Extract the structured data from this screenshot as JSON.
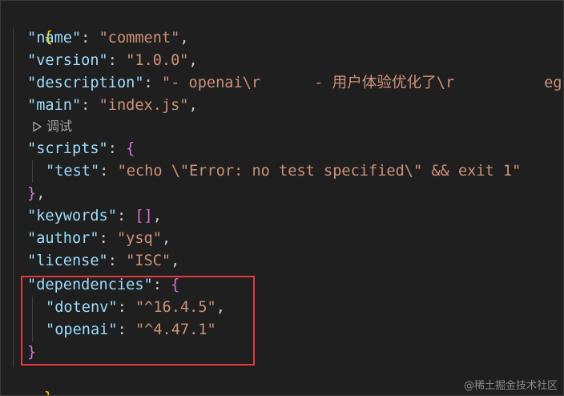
{
  "editor": {
    "open_brace": "{",
    "close_brace": "}",
    "codelens_label": "调试",
    "codelens_icon": "play-icon",
    "lines": {
      "name": {
        "key": "\"name\"",
        "sep": ": ",
        "value": "\"comment\"",
        "end": ","
      },
      "version": {
        "key": "\"version\"",
        "sep": ": ",
        "value": "\"1.0.0\"",
        "end": ","
      },
      "description": {
        "key": "\"description\"",
        "sep": ": ",
        "value": "\"- openai\\r      - 用户体验优化了\\r          eg"
      },
      "main": {
        "key": "\"main\"",
        "sep": ": ",
        "value": "\"index.js\"",
        "end": ","
      },
      "scripts": {
        "key": "\"scripts\"",
        "sep": ": ",
        "open": "{"
      },
      "test": {
        "key": "\"test\"",
        "sep": ": ",
        "value": "\"echo \\\"Error: no test specified\\\" && exit 1\""
      },
      "scripts_close": {
        "close": "}",
        "end": ","
      },
      "keywords": {
        "key": "\"keywords\"",
        "sep": ": ",
        "value": "[]",
        "end": ","
      },
      "author": {
        "key": "\"author\"",
        "sep": ": ",
        "value": "\"ysq\"",
        "end": ","
      },
      "license": {
        "key": "\"license\"",
        "sep": ": ",
        "value": "\"ISC\"",
        "end": ","
      },
      "dependencies": {
        "key": "\"dependencies\"",
        "sep": ": ",
        "open": "{"
      },
      "dotenv": {
        "key": "\"dotenv\"",
        "sep": ": ",
        "value": "\"^16.4.5\"",
        "end": ","
      },
      "openai": {
        "key": "\"openai\"",
        "sep": ": ",
        "value": "\"^4.47.1\""
      },
      "dependencies_close": {
        "close": "}"
      }
    }
  },
  "watermark": "@稀土掘金技术社区",
  "colors": {
    "background": "#1f1f1f",
    "json_key": "#9cdcfe",
    "json_string": "#ce9178",
    "bracket_level1": "#ffd700",
    "bracket_level2": "#da70d6",
    "bracket_level3": "#179fff",
    "highlight_box": "#e5393b"
  }
}
